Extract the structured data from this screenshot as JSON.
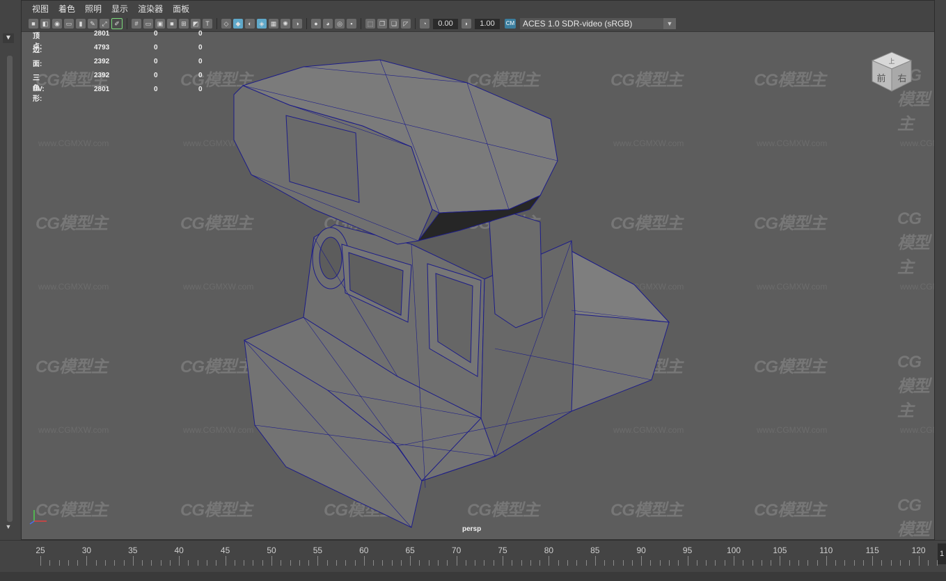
{
  "menu": [
    "视图",
    "着色",
    "照明",
    "显示",
    "渲染器",
    "面板"
  ],
  "toolbar": {
    "field_a": "0.00",
    "field_b": "1.00",
    "colorspace": "ACES 1.0 SDR-video (sRGB)",
    "colorspace_icon": "CM"
  },
  "hud": {
    "rows": [
      {
        "label": "顶点:",
        "v1": "2801",
        "v2": "0",
        "v3": "0"
      },
      {
        "label": "边:",
        "v1": "4793",
        "v2": "0",
        "v3": "0"
      },
      {
        "label": "面:",
        "v1": "2392",
        "v2": "0",
        "v3": "0"
      },
      {
        "label": "三角形:",
        "v1": "2392",
        "v2": "0",
        "v3": "0"
      },
      {
        "label": "UV:",
        "v1": "2801",
        "v2": "0",
        "v3": "0"
      }
    ]
  },
  "viewcube": {
    "top": "上",
    "front": "前",
    "right": "右"
  },
  "camera_label": "persp",
  "watermark": {
    "logo": "CG模型主",
    "url": "www.CGMXW.com"
  },
  "timeline": {
    "ticks": [
      "25",
      "30",
      "35",
      "40",
      "45",
      "50",
      "55",
      "60",
      "65",
      "70",
      "75",
      "80",
      "85",
      "90",
      "95",
      "100",
      "105",
      "110",
      "115",
      "120"
    ],
    "current_frame": "1"
  }
}
